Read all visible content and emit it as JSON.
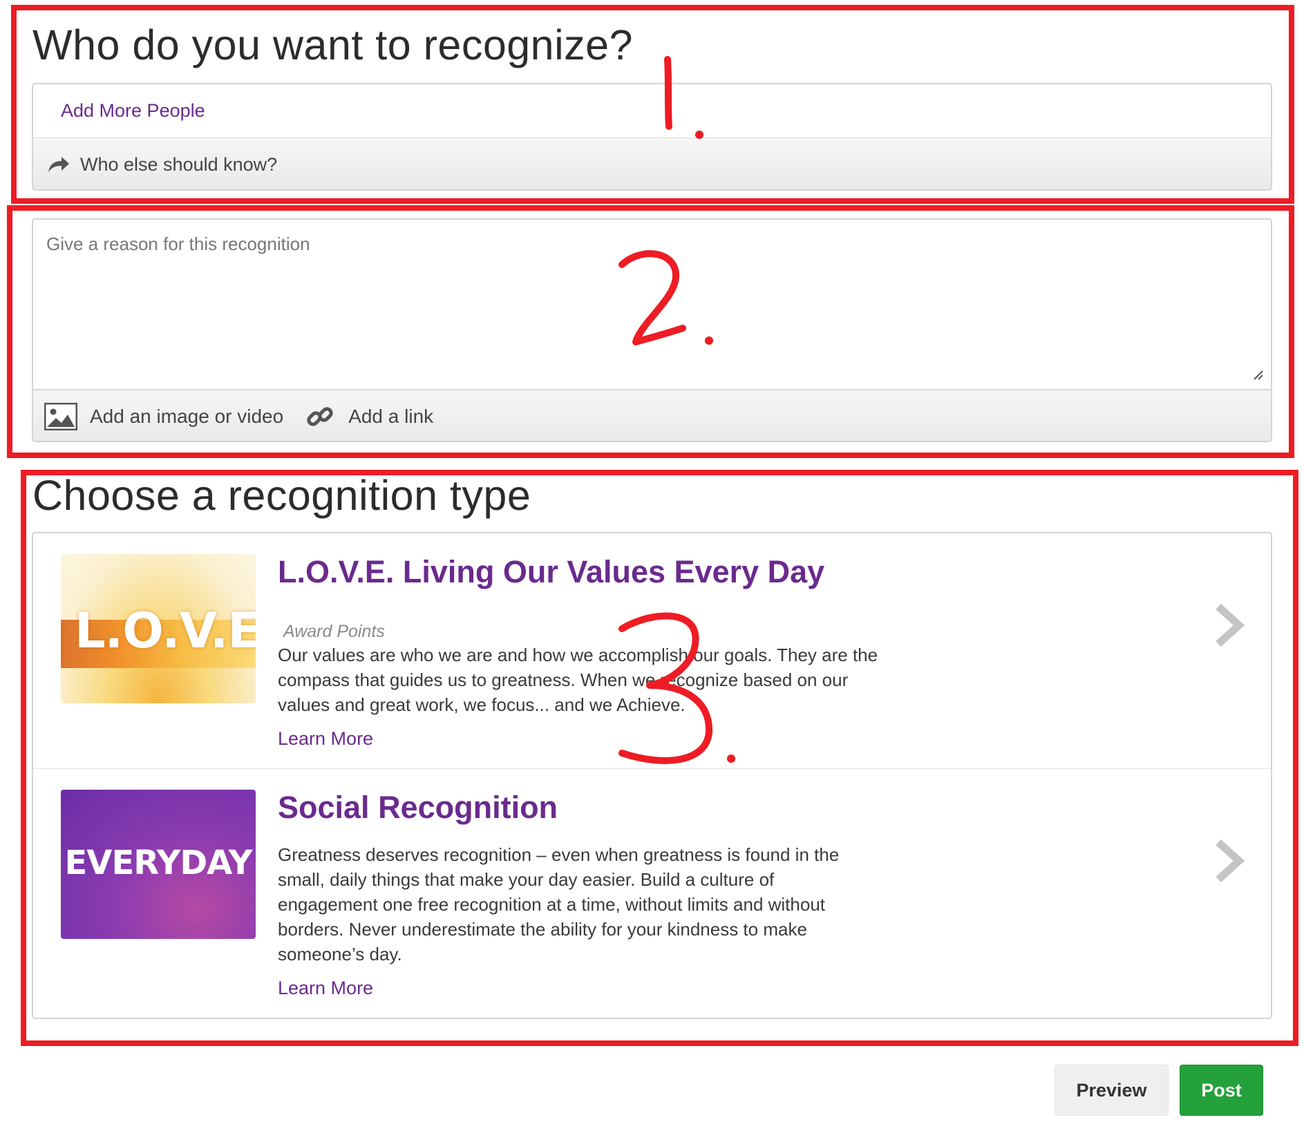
{
  "recipients": {
    "heading": "Who do you want to recognize?",
    "add_people_label": "Add More People",
    "notify_label": "Who else should know?"
  },
  "reason": {
    "placeholder": "Give a reason for this recognition",
    "add_media_label": "Add an image or video",
    "add_link_label": "Add a link"
  },
  "types": {
    "heading": "Choose a recognition type",
    "items": [
      {
        "title": "L.O.V.E. Living Our Values Every Day",
        "thumb_text": "L.O.V.E.",
        "subtitle": "Award Points",
        "description": "Our values are who we are and how we accomplish our goals. They are the compass that guides us to greatness. When we recognize based on our values and great work, we focus... and we Achieve.",
        "learn_more": "Learn More"
      },
      {
        "title": "Social Recognition",
        "thumb_text": "EVERYDAY",
        "description": "Greatness deserves recognition – even when greatness is found in the small, daily things that make your day easier. Build a culture of engagement one free recognition at a time, without limits and without borders. Never underestimate the ability for your kindness to make someone’s day.",
        "learn_more": "Learn More"
      }
    ]
  },
  "actions": {
    "preview_label": "Preview",
    "post_label": "Post"
  },
  "annotations": {
    "marks": [
      "1.",
      "2.",
      "3."
    ],
    "color": "#ee1c24"
  },
  "colors": {
    "accent": "#6a2a8e",
    "post_button": "#24a13a"
  }
}
